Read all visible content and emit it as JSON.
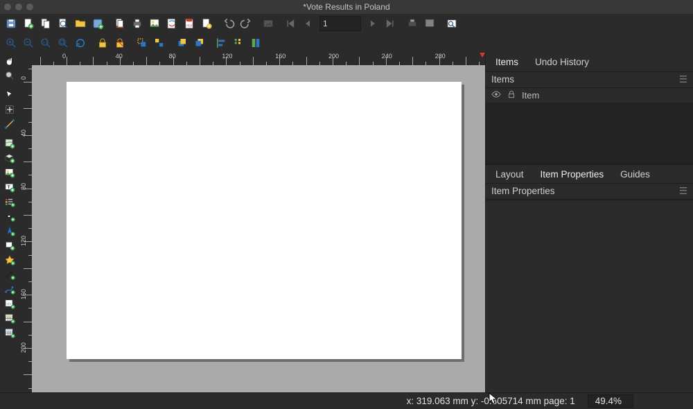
{
  "titlebar": {
    "title": "*Vote Results in Poland"
  },
  "toolbar1": {
    "page_value": "1"
  },
  "right": {
    "tabs1": {
      "items": "Items",
      "undo_history": "Undo History"
    },
    "items_header": "Items",
    "item_col": "Item",
    "tabs2": {
      "layout": "Layout",
      "item_properties": "Item Properties",
      "guides": "Guides"
    },
    "item_props_header": "Item Properties"
  },
  "status": {
    "coords": "x: 319.063 mm  y: -0.805714 mm  page: 1",
    "zoom": "49.4%"
  }
}
